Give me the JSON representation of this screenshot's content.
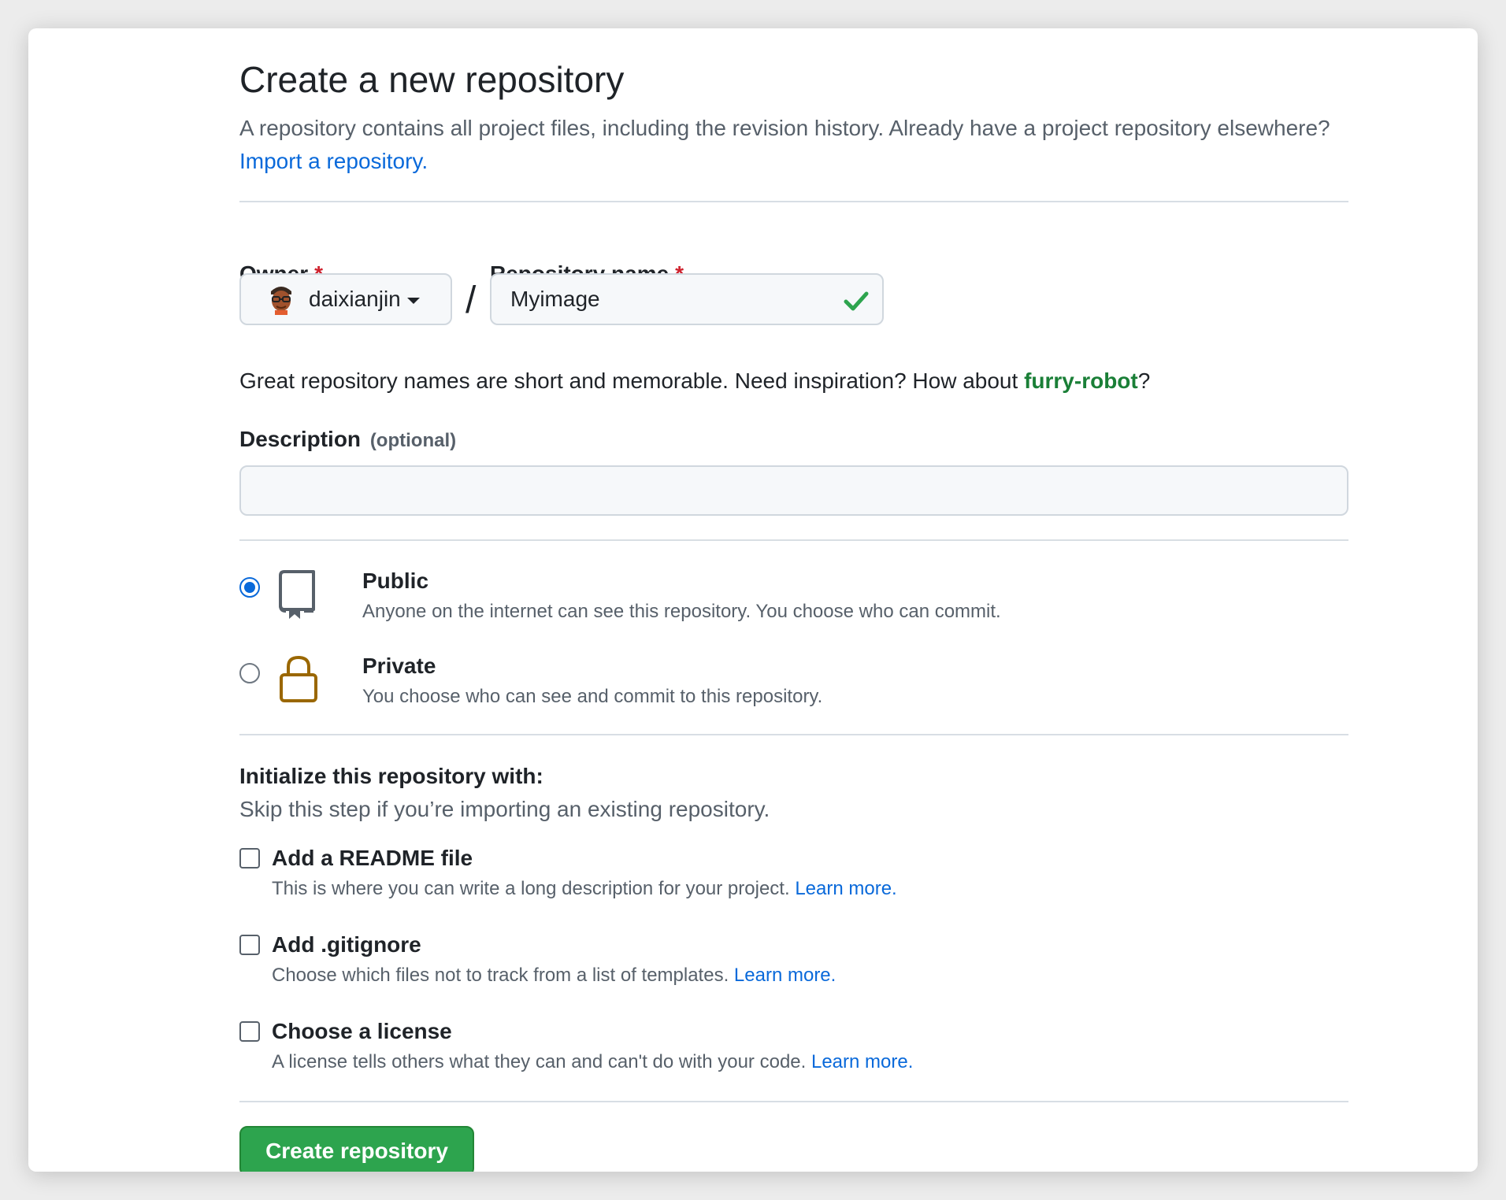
{
  "page": {
    "title": "Create a new repository",
    "subtitle": "A repository contains all project files, including the revision history. Already have a project repository elsewhere?",
    "import_link": "Import a repository."
  },
  "owner": {
    "label": "Owner",
    "required_mark": "*",
    "value": "daixianjin",
    "avatar_icon": "user-avatar",
    "dropdown_icon": "caret-down-icon"
  },
  "separator": "/",
  "repo_name": {
    "label": "Repository name",
    "required_mark": "*",
    "value": "Myimage",
    "valid_icon": "check-icon",
    "valid_color": "#2da44e"
  },
  "name_hint": {
    "text": "Great repository names are short and memorable. Need inspiration? How about",
    "suggestion": "furry-robot",
    "suffix": "?"
  },
  "description": {
    "label": "Description",
    "optional": "(optional)",
    "value": ""
  },
  "visibility": {
    "selected": "public",
    "options": [
      {
        "id": "public",
        "title": "Public",
        "desc": "Anyone on the internet can see this repository. You choose who can commit.",
        "icon": "repo-icon"
      },
      {
        "id": "private",
        "title": "Private",
        "desc": "You choose who can see and commit to this repository.",
        "icon": "lock-icon",
        "icon_color": "#9a6700"
      }
    ]
  },
  "init": {
    "title": "Initialize this repository with:",
    "subtitle": "Skip this step if you’re importing an existing repository.",
    "options": [
      {
        "title": "Add a README file",
        "desc": "This is where you can write a long description for your project.",
        "link": "Learn more.",
        "checked": false
      },
      {
        "title": "Add .gitignore",
        "desc": "Choose which files not to track from a list of templates.",
        "link": "Learn more.",
        "checked": false
      },
      {
        "title": "Choose a license",
        "desc": "A license tells others what they can and can't do with your code.",
        "link": "Learn more.",
        "checked": false
      }
    ]
  },
  "submit": {
    "label": "Create repository",
    "color": "#2da44e"
  },
  "colors": {
    "link": "#0969da",
    "required": "#cf222e",
    "suggestion": "#1a7f37"
  }
}
